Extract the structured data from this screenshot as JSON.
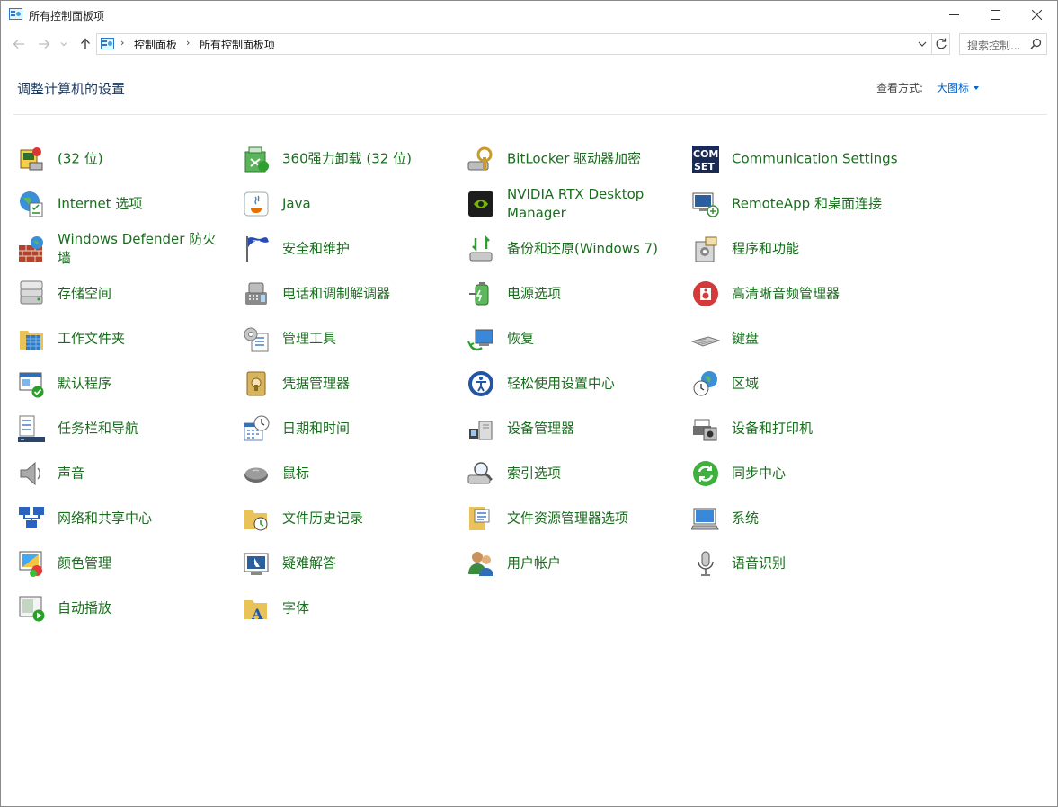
{
  "window": {
    "title": "所有控制面板项",
    "controls": {
      "minimize": "—",
      "maximize": "☐",
      "close": "✕"
    }
  },
  "address": {
    "breadcrumbs": [
      "控制面板",
      "所有控制面板项"
    ],
    "search_placeholder": "搜索控制..."
  },
  "header": {
    "title": "调整计算机的设置",
    "view_label": "查看方式:",
    "view_value": "大图标"
  },
  "columns": [
    [
      {
        "label": "(32 位)",
        "icon": "setup-wizard-icon"
      },
      {
        "label": "Internet 选项",
        "icon": "internet-options-icon"
      },
      {
        "label": "Windows Defender 防火墙",
        "icon": "firewall-icon"
      },
      {
        "label": "存储空间",
        "icon": "storage-spaces-icon"
      },
      {
        "label": "工作文件夹",
        "icon": "work-folders-icon"
      },
      {
        "label": "默认程序",
        "icon": "default-programs-icon"
      },
      {
        "label": "任务栏和导航",
        "icon": "taskbar-icon"
      },
      {
        "label": "声音",
        "icon": "sound-icon"
      },
      {
        "label": "网络和共享中心",
        "icon": "network-icon"
      },
      {
        "label": "颜色管理",
        "icon": "color-management-icon"
      },
      {
        "label": "自动播放",
        "icon": "autoplay-icon"
      }
    ],
    [
      {
        "label": "360强力卸载 (32 位)",
        "icon": "uninstaller-icon"
      },
      {
        "label": "Java",
        "icon": "java-icon"
      },
      {
        "label": "安全和维护",
        "icon": "security-flag-icon"
      },
      {
        "label": "电话和调制解调器",
        "icon": "phone-modem-icon"
      },
      {
        "label": "管理工具",
        "icon": "admin-tools-icon"
      },
      {
        "label": "凭据管理器",
        "icon": "credential-manager-icon"
      },
      {
        "label": "日期和时间",
        "icon": "date-time-icon"
      },
      {
        "label": "鼠标",
        "icon": "mouse-icon"
      },
      {
        "label": "文件历史记录",
        "icon": "file-history-icon"
      },
      {
        "label": "疑难解答",
        "icon": "troubleshoot-icon"
      },
      {
        "label": "字体",
        "icon": "fonts-icon"
      }
    ],
    [
      {
        "label": "BitLocker 驱动器加密",
        "icon": "bitlocker-icon"
      },
      {
        "label": "NVIDIA RTX Desktop Manager",
        "icon": "nvidia-icon"
      },
      {
        "label": "备份和还原(Windows 7)",
        "icon": "backup-restore-icon"
      },
      {
        "label": "电源选项",
        "icon": "power-options-icon"
      },
      {
        "label": "恢复",
        "icon": "recovery-icon"
      },
      {
        "label": "轻松使用设置中心",
        "icon": "ease-of-access-icon"
      },
      {
        "label": "设备管理器",
        "icon": "device-manager-icon"
      },
      {
        "label": "索引选项",
        "icon": "indexing-icon"
      },
      {
        "label": "文件资源管理器选项",
        "icon": "explorer-options-icon"
      },
      {
        "label": "用户帐户",
        "icon": "user-accounts-icon"
      }
    ],
    [
      {
        "label": "Communication Settings",
        "icon": "com-set-icon"
      },
      {
        "label": "RemoteApp 和桌面连接",
        "icon": "remoteapp-icon"
      },
      {
        "label": "程序和功能",
        "icon": "programs-features-icon"
      },
      {
        "label": "高清晰音频管理器",
        "icon": "hd-audio-icon"
      },
      {
        "label": "键盘",
        "icon": "keyboard-icon"
      },
      {
        "label": "区域",
        "icon": "region-icon"
      },
      {
        "label": "设备和打印机",
        "icon": "printer-icon"
      },
      {
        "label": "同步中心",
        "icon": "sync-center-icon"
      },
      {
        "label": "系统",
        "icon": "system-icon"
      },
      {
        "label": "语音识别",
        "icon": "microphone-icon"
      }
    ]
  ]
}
